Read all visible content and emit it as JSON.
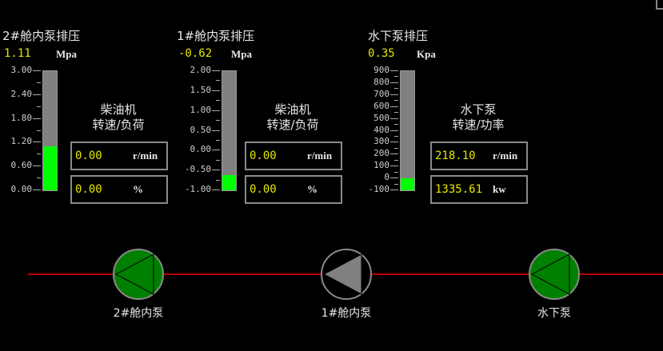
{
  "gauges": [
    {
      "title": "2#舱内泵排压",
      "value": "1.11",
      "unit": "Mpa",
      "ticks": [
        "3.00",
        "2.40",
        "1.80",
        "1.20",
        "0.60",
        "0.00"
      ],
      "min": 0,
      "max": 3,
      "level": 1.11,
      "engine_title": "柴油机",
      "engine_subtitle": "转速/负荷",
      "speed": "0.00",
      "speed_unit": "r/min",
      "load": "0.00",
      "load_unit": "%"
    },
    {
      "title": "1#舱内泵排压",
      "value": "-0.62",
      "unit": "Mpa",
      "ticks": [
        "2.00",
        "1.50",
        "1.00",
        "0.50",
        "0.00",
        "-0.50",
        "-1.00"
      ],
      "min": -1,
      "max": 2,
      "level": -0.62,
      "engine_title": "柴油机",
      "engine_subtitle": "转速/负荷",
      "speed": "0.00",
      "speed_unit": "r/min",
      "load": "0.00",
      "load_unit": "%"
    },
    {
      "title": "水下泵排压",
      "value": "0.35",
      "unit": "Kpa",
      "ticks": [
        "900",
        "800",
        "700",
        "600",
        "500",
        "400",
        "300",
        "200",
        "100",
        "0",
        "-100"
      ],
      "min": -100,
      "max": 900,
      "level": 0.35,
      "engine_title": "水下泵",
      "engine_subtitle": "转速/功率",
      "speed": "218.10",
      "speed_unit": "r/min",
      "load": "1335.61",
      "load_unit": "kw"
    }
  ],
  "pumps": [
    {
      "label": "2#舱内泵",
      "state": "running",
      "color": "#008000"
    },
    {
      "label": "1#舱内泵",
      "state": "stopped",
      "color": "#000000"
    },
    {
      "label": "水下泵",
      "state": "running",
      "color": "#008000"
    }
  ],
  "colors": {
    "pipe": "#c00000",
    "value": "#e6e600",
    "fill": "#00ff00"
  }
}
